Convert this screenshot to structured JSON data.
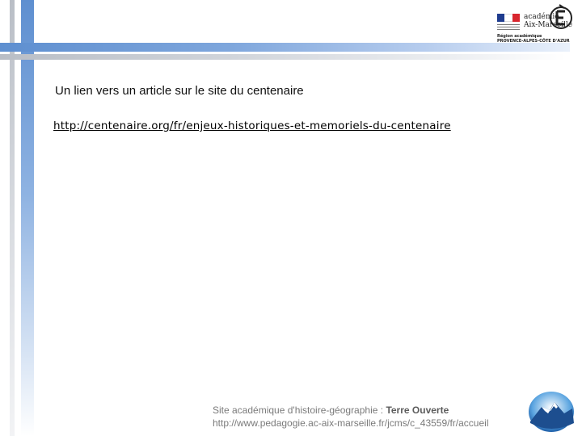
{
  "header": {
    "logo_line1": "académie",
    "logo_line2": "Aix-Marseille",
    "region_line1": "Région académique",
    "region_line2": "PROVENCE-ALPES-CÔTE D'AZUR"
  },
  "content": {
    "intro": "Un lien vers un article sur le site du centenaire",
    "link": "http://centenaire.org/fr/enjeux-historiques-et-memoriels-du-centenaire"
  },
  "footer": {
    "site_prefix": "Site académique d'histoire-géographie : ",
    "site_name": "Terre Ouverte",
    "url": "http://www.pedagogie.ac-aix-marseille.fr/jcms/c_43559/fr/accueil"
  },
  "colors": {
    "accent_blue": "#5e8fd0",
    "flag_blue": "#1f3c8f",
    "flag_red": "#d8262e"
  }
}
